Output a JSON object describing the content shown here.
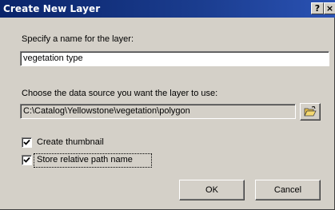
{
  "window": {
    "title": "Create New Layer",
    "help_glyph": "?",
    "close_glyph": "×"
  },
  "name_section": {
    "label": "Specify a name for the layer:",
    "value": "vegetation type"
  },
  "source_section": {
    "label": "Choose the data source you want the layer to use:",
    "value": "C:\\Catalog\\Yellowstone\\vegetation\\polygon",
    "browse_icon": "open-folder-icon"
  },
  "options": {
    "create_thumbnail": {
      "label": "Create thumbnail",
      "checked": true
    },
    "store_relative_path": {
      "label": "Store relative path name",
      "checked": true
    }
  },
  "buttons": {
    "ok_label": "OK",
    "cancel_label": "Cancel"
  },
  "colors": {
    "titlebar": "#0a246a",
    "dialog_face": "#d4d0c8"
  }
}
